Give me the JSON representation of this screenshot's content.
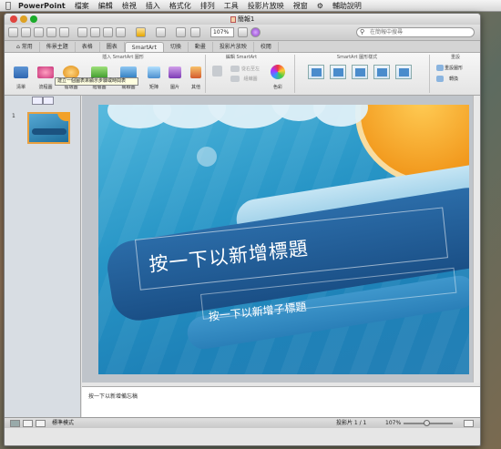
{
  "menubar": {
    "app_name": "PowerPoint",
    "items": [
      "檔案",
      "編輯",
      "檢視",
      "插入",
      "格式化",
      "排列",
      "工具",
      "投影片放映",
      "視窗",
      "輔助說明"
    ]
  },
  "window": {
    "title": "簡報1"
  },
  "toolbar": {
    "zoom": "107%",
    "search_placeholder": "在簡報中搜尋"
  },
  "ribbon_tabs": [
    "常用",
    "佈景主題",
    "表格",
    "圖表",
    "SmartArt",
    "切換",
    "動畫",
    "投影片放映",
    "校閱"
  ],
  "active_tab": "SmartArt",
  "ribbon_groups": {
    "insert": "插入 SmartArt 圖形",
    "edit": "編輯 SmartArt",
    "styles": "SmartArt 圖形樣式",
    "reset": "重設"
  },
  "ribbon_buttons": [
    "清單",
    "流程圖",
    "循環圖",
    "階層圖",
    "關聯圖",
    "矩陣",
    "圖片",
    "其他"
  ],
  "edit_buttons": [
    "從右至左",
    "組織圖",
    "色彩"
  ],
  "reset_buttons": [
    "重設圖形",
    "轉換"
  ],
  "tooltip": "建立一個圖表來顯示步驟或時間表",
  "slide": {
    "number": "1",
    "title": "按一下以新增標題",
    "subtitle": "按一下以新增子標題"
  },
  "notes_placeholder": "按一下以新增備忘稿",
  "status": {
    "view": "標準模式",
    "slide_count": "投影片 1 / 1",
    "zoom": "107%"
  }
}
